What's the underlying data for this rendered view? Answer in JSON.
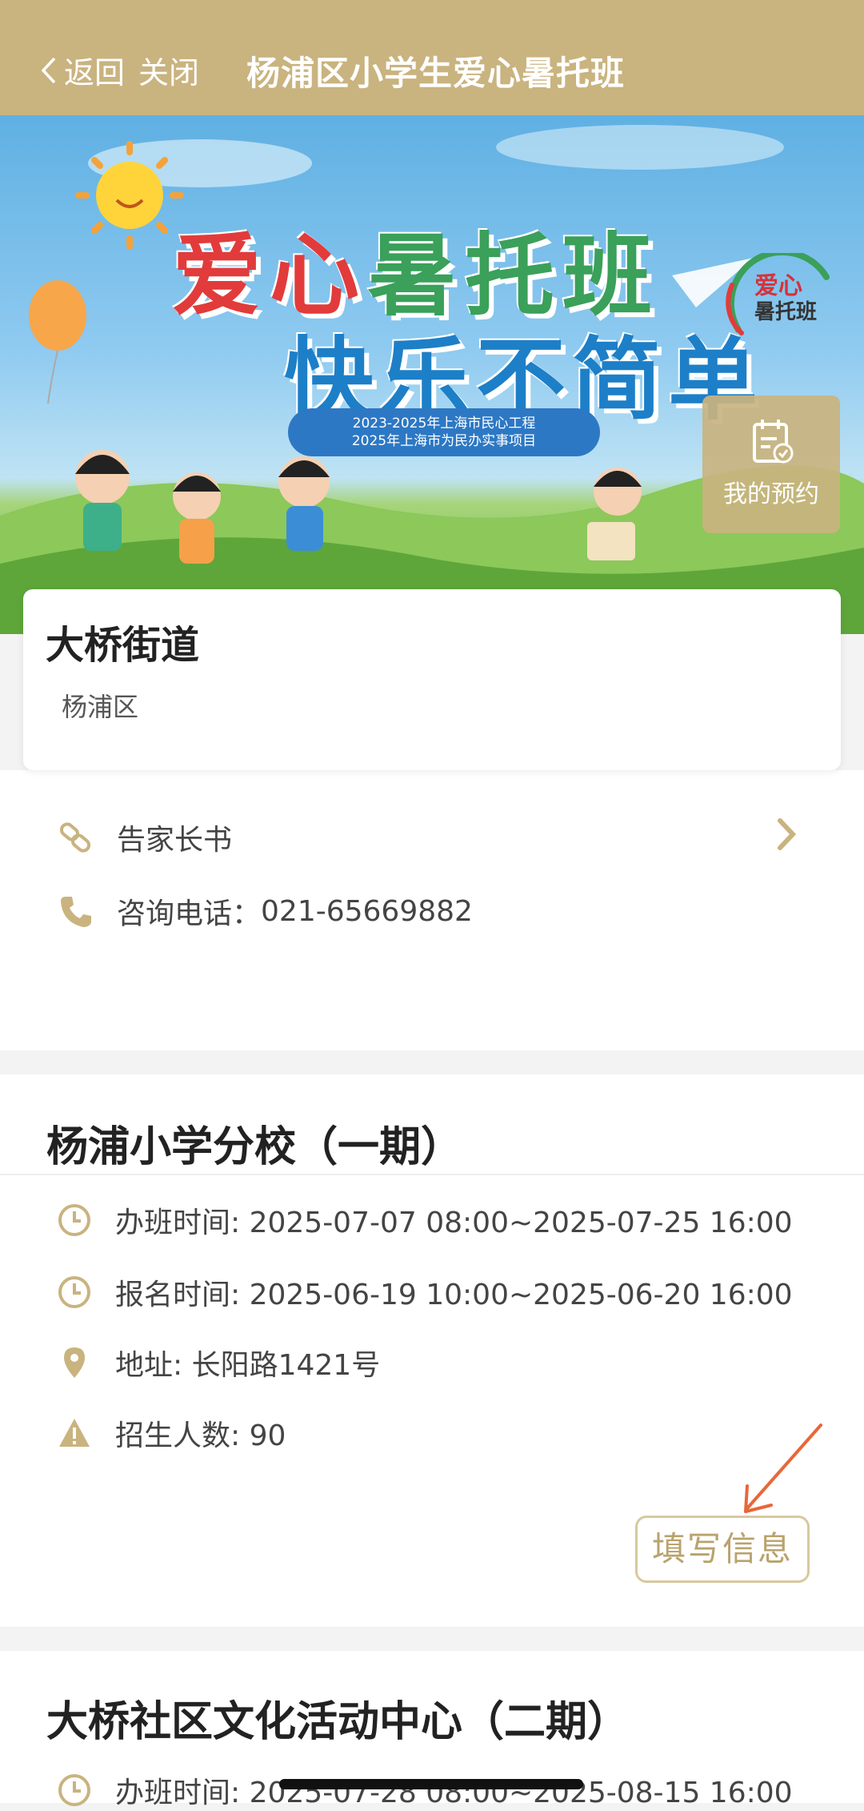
{
  "topbar": {
    "back_label": "返回",
    "close_label": "关闭",
    "title": "杨浦区小学生爱心暑托班"
  },
  "banner": {
    "headline1_red": "爱心",
    "headline1_green": "暑托班",
    "headline2": "快乐不简单",
    "ribbon_line1": "2023-2025年上海市民心工程",
    "ribbon_line2": "2025年上海市为民办实事项目",
    "logo_line1": "爱心",
    "logo_line2": "暑托班"
  },
  "my_reservation": {
    "label": "我的预约",
    "icon": "calendar-check-icon"
  },
  "info": {
    "name": "大桥街道",
    "district": "杨浦区"
  },
  "links": {
    "parent_letter": "告家长书",
    "phone_label": "咨询电话：",
    "phone": "021-65669882"
  },
  "classes": [
    {
      "title": "杨浦小学分校（一期）",
      "class_time": "办班时间: 2025-07-07 08:00~2025-07-25 16:00",
      "signup_time": "报名时间: 2025-06-19 10:00~2025-06-20 16:00",
      "address": "地址: 长阳路1421号",
      "quota": "招生人数: 90",
      "button": "填写信息"
    },
    {
      "title": "大桥社区文化活动中心（二期）",
      "class_time": "办班时间: 2025-07-28 08:00~2025-08-15 16:00"
    }
  ],
  "colors": {
    "brand": "#c9b37f",
    "icon": "#c9b37f",
    "annotation_arrow": "#e8673a"
  }
}
